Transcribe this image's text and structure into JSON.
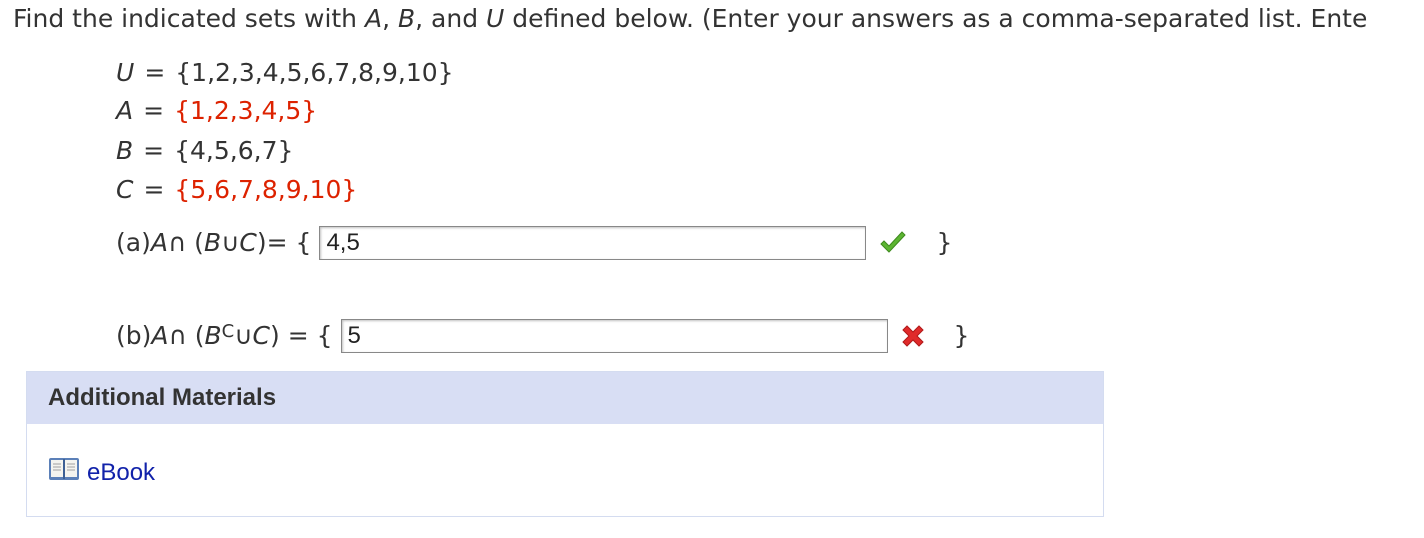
{
  "instructions": {
    "part1": "Find the indicated sets with ",
    "var_a": "A",
    "part2": ", ",
    "var_b": "B",
    "part3": ", and ",
    "var_u": "U",
    "part4": " defined below. (Enter your answers as a comma-separated list. Ente"
  },
  "sets": {
    "u": {
      "name": "U",
      "value": "{1,2,3,4,5,6,7,8,9,10}"
    },
    "a": {
      "name": "A",
      "value": "{1,2,3,4,5}"
    },
    "b": {
      "name": "B",
      "value": "{4,5,6,7}"
    },
    "c": {
      "name": "C",
      "value": "{5,6,7,8,9,10}"
    }
  },
  "part_a": {
    "label": "(a) ",
    "v1": "A",
    "op1": " ∩ (",
    "v2": "B",
    "op2": " ∪ ",
    "v3": "C",
    "tail": ")= {",
    "answer": "4,5",
    "close": "}",
    "status": "correct"
  },
  "part_b": {
    "label": "(b) ",
    "v1": "A",
    "op1": " ∩ (",
    "v2": "B",
    "sup": "C",
    "op2": " ∪ ",
    "v3": "C",
    "tail": ") = {",
    "answer": "5",
    "close": "}",
    "status": "incorrect"
  },
  "additional_materials": {
    "title": "Additional Materials",
    "link_icon": "book-icon",
    "link_label": "eBook"
  },
  "colors": {
    "highlight_red": "#dd2200",
    "correct_green": "#5cb531",
    "incorrect_red": "#e02a2a",
    "header_bg": "#d8def4",
    "link_blue": "#1122aa"
  }
}
